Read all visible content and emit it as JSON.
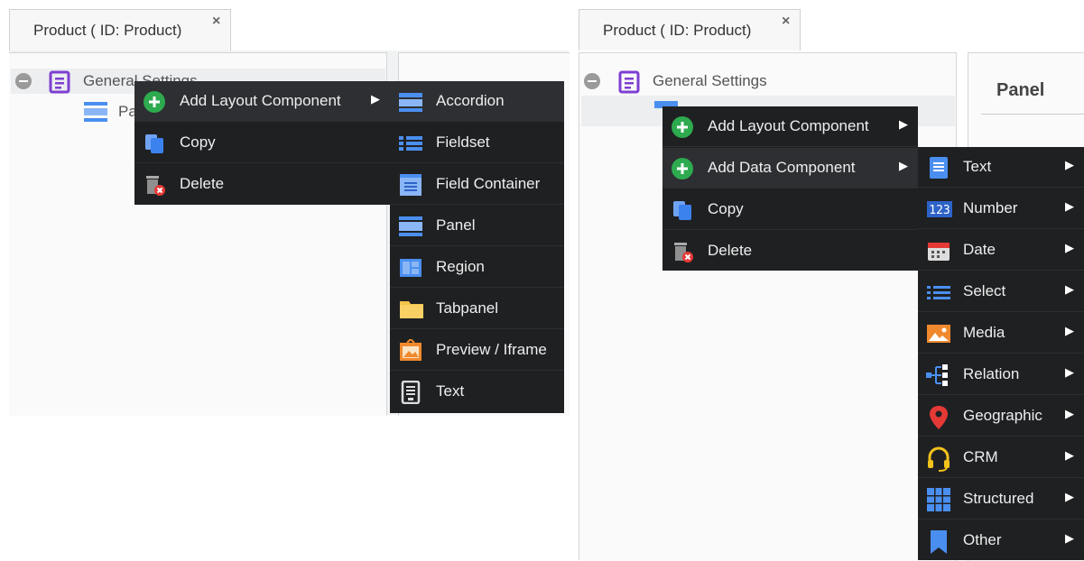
{
  "left": {
    "tab_title": "Product ( ID: Product)",
    "tab_close": "×",
    "tree": {
      "root": "General Settings",
      "child_partial": "Pa"
    },
    "menu": [
      {
        "label": "Add Layout Component",
        "has_submenu": true
      },
      {
        "label": "Copy",
        "has_submenu": false
      },
      {
        "label": "Delete",
        "has_submenu": false
      }
    ],
    "submenu": [
      {
        "label": "Accordion",
        "icon": "accordion-icon"
      },
      {
        "label": "Fieldset",
        "icon": "fieldset-icon"
      },
      {
        "label": "Field Container",
        "icon": "field-container-icon"
      },
      {
        "label": "Panel",
        "icon": "panel-icon"
      },
      {
        "label": "Region",
        "icon": "region-icon"
      },
      {
        "label": "Tabpanel",
        "icon": "tabpanel-icon"
      },
      {
        "label": "Preview / Iframe",
        "icon": "preview-iframe-icon"
      },
      {
        "label": "Text",
        "icon": "text-icon"
      }
    ]
  },
  "right": {
    "tab_title": "Product ( ID: Product)",
    "tab_close": "×",
    "tree": {
      "root": "General Settings"
    },
    "panel_header": "Panel",
    "menu": [
      {
        "label": "Add Layout Component",
        "has_submenu": true
      },
      {
        "label": "Add Data Component",
        "has_submenu": true
      },
      {
        "label": "Copy",
        "has_submenu": false
      },
      {
        "label": "Delete",
        "has_submenu": false
      }
    ],
    "submenu": [
      {
        "label": "Text",
        "icon": "text-field-icon"
      },
      {
        "label": "Number",
        "icon": "number-icon"
      },
      {
        "label": "Date",
        "icon": "calendar-icon"
      },
      {
        "label": "Select",
        "icon": "list-icon"
      },
      {
        "label": "Media",
        "icon": "image-icon"
      },
      {
        "label": "Relation",
        "icon": "relation-icon"
      },
      {
        "label": "Geographic",
        "icon": "map-pin-icon"
      },
      {
        "label": "CRM",
        "icon": "headset-icon"
      },
      {
        "label": "Structured",
        "icon": "grid-icon"
      },
      {
        "label": "Other",
        "icon": "bookmark-icon"
      }
    ]
  },
  "colors": {
    "menu_bg": "#1f2022",
    "accent_blue": "#4a8ff0",
    "add_green": "#2eaa4f",
    "delete_red": "#e53935",
    "tree_purple": "#7e3fd1"
  }
}
